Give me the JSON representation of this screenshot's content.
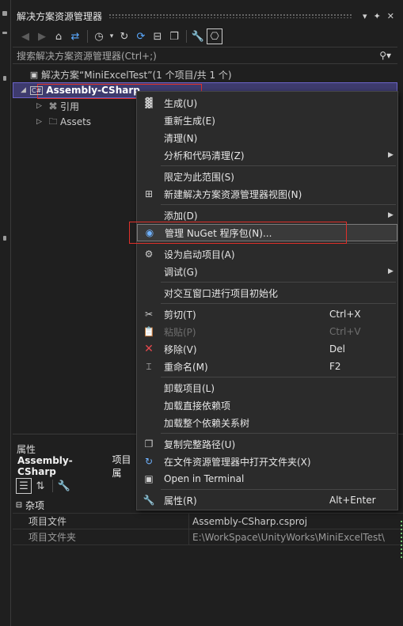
{
  "window": {
    "title": "解决方案资源管理器",
    "controls": {
      "dropdown": "▾",
      "pin": "📌",
      "close": "✕"
    }
  },
  "search": {
    "placeholder": "搜索解决方案资源管理器(Ctrl+;)"
  },
  "tree": {
    "solution": "解决方案“MiniExcelTest”(1 个项目/共 1 个)",
    "project": "Assembly-CSharp",
    "project_badge": "C#",
    "children": [
      {
        "label": "引用"
      },
      {
        "label": "Assets"
      }
    ]
  },
  "properties": {
    "title": "属性",
    "object": "Assembly-CSharp",
    "object_type": "项目属",
    "category": "杂项",
    "rows": [
      {
        "key": "项目文件",
        "value": "Assembly-CSharp.csproj"
      },
      {
        "key": "项目文件夹",
        "value": "E:\\WorkSpace\\UnityWorks\\MiniExcelTest\\"
      }
    ]
  },
  "context_menu": {
    "items": [
      {
        "label": "生成(U)",
        "shortcut": "",
        "icon": "build-icon"
      },
      {
        "label": "重新生成(E)",
        "shortcut": ""
      },
      {
        "label": "清理(N)",
        "shortcut": ""
      },
      {
        "label": "分析和代码清理(Z)",
        "shortcut": "",
        "submenu": true
      },
      {
        "label": "限定为此范围(S)",
        "shortcut": ""
      },
      {
        "label": "新建解决方案资源管理器视图(N)",
        "shortcut": "",
        "icon": "new-view-icon"
      },
      {
        "label": "添加(D)",
        "shortcut": "",
        "submenu": true
      },
      {
        "label": "管理 NuGet 程序包(N)...",
        "shortcut": "",
        "icon": "nuget-icon"
      },
      {
        "label": "设为启动项目(A)",
        "shortcut": "",
        "icon": "gear-icon"
      },
      {
        "label": "调试(G)",
        "shortcut": "",
        "submenu": true
      },
      {
        "label": "对交互窗口进行项目初始化",
        "shortcut": ""
      },
      {
        "label": "剪切(T)",
        "shortcut": "Ctrl+X",
        "icon": "cut-icon"
      },
      {
        "label": "粘贴(P)",
        "shortcut": "Ctrl+V",
        "icon": "paste-icon",
        "disabled": true
      },
      {
        "label": "移除(V)",
        "shortcut": "Del",
        "icon": "remove-icon"
      },
      {
        "label": "重命名(M)",
        "shortcut": "F2",
        "icon": "rename-icon"
      },
      {
        "label": "卸载项目(L)",
        "shortcut": ""
      },
      {
        "label": "加载直接依赖项",
        "shortcut": ""
      },
      {
        "label": "加载整个依赖关系树",
        "shortcut": ""
      },
      {
        "label": "复制完整路径(U)",
        "shortcut": "",
        "icon": "copy-path-icon"
      },
      {
        "label": "在文件资源管理器中打开文件夹(X)",
        "shortcut": "",
        "icon": "open-folder-icon"
      },
      {
        "label": "Open in Terminal",
        "shortcut": "",
        "icon": "terminal-icon"
      },
      {
        "label": "属性(R)",
        "shortcut": "Alt+Enter",
        "icon": "wrench-icon"
      }
    ]
  },
  "colors": {
    "selection": "#3e3b6e",
    "highlight_box": "#e0302a",
    "accent": "#5aa9ff"
  }
}
